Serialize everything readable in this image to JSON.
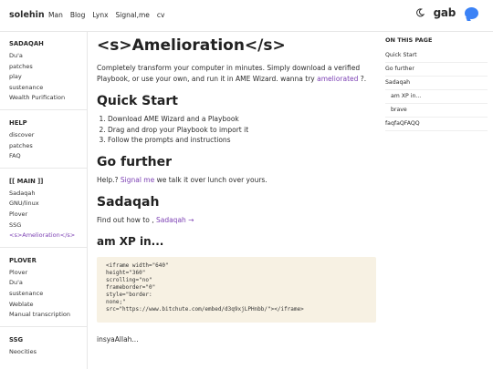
{
  "header": {
    "brand": "solehin",
    "nav": [
      "Man",
      "Blog",
      "Lynx",
      "Signal,me",
      "cv"
    ],
    "gab": "gab"
  },
  "sidebar": {
    "sections": [
      {
        "title": "SADAQAH",
        "items": [
          "Du'a",
          "patches",
          "play",
          "sustenance",
          "Wealth Purification"
        ]
      },
      {
        "title": "HELP",
        "items": [
          "discover",
          "patches",
          "FAQ"
        ]
      },
      {
        "title": "[[ MAIN ]]",
        "items": [
          "Sadaqah",
          "GNU/linux",
          "Plover",
          "SSG",
          "<s>Amelioration</s>"
        ],
        "active": "<s>Amelioration</s>"
      },
      {
        "title": "PLOVER",
        "items": [
          "Plover",
          "Du'a",
          "sustenance",
          "Weblate",
          "Manual transcription"
        ]
      },
      {
        "title": "SSG",
        "items": [
          "Neocities"
        ]
      }
    ]
  },
  "main": {
    "title": "<s>Amelioration</s>",
    "intro_1": "Completely transform your computer in minutes. Simply download a verified Playbook, or use your own, and run it in AME Wizard. wanna try ",
    "intro_link": "ameliorated",
    "intro_2": " ?.",
    "quick_start": "Quick Start",
    "steps": [
      "Download AME Wizard and a Playbook",
      "Drag and drop your Playbook to import it",
      "Follow the prompts and instructions"
    ],
    "go_further": "Go further",
    "go_further_1": "Help.? ",
    "go_further_link": "Signal me",
    "go_further_2": " we talk it over lunch over yours.",
    "sadaqah": "Sadaqah",
    "sadaqah_text_1": "Find out how to , ",
    "sadaqah_link": "Sadaqah →",
    "am_xp": "am XP in...",
    "code": "<iframe width=\"640\"\nheight=\"360\"\nscrolling=\"no\"\nframeborder=\"0\"\nstyle=\"border:\nnone;\"\nsrc=\"https://www.bitchute.com/embed/d3q9xjLPHnbb/\"></iframe>",
    "footer_text": "insyaAllah..."
  },
  "toc": {
    "title": "ON THIS PAGE",
    "items": [
      "Quick Start",
      "Go further",
      "Sadaqah",
      "am XP in...",
      "brave",
      "faqfaQFAQQ"
    ]
  }
}
